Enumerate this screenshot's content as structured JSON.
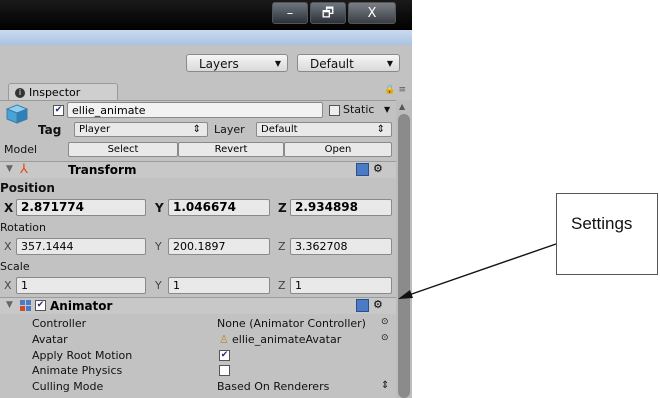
{
  "window": {
    "minimize": "–",
    "maximize": "🗗",
    "close": "X"
  },
  "toolbar": {
    "layers": "Layers",
    "layout": "Default"
  },
  "tab": {
    "label": "Inspector"
  },
  "object": {
    "name": "ellie_animate",
    "static_label": "Static",
    "tag_label": "Tag",
    "tag_value": "Player",
    "layer_label": "Layer",
    "layer_value": "Default",
    "model_label": "Model",
    "select": "Select",
    "revert": "Revert",
    "open": "Open"
  },
  "transform": {
    "title": "Transform",
    "position_label": "Position",
    "position": {
      "x": "2.871774",
      "y": "1.046674",
      "z": "2.934898"
    },
    "rotation_label": "Rotation",
    "rotation": {
      "x": "357.1444",
      "y": "200.1897",
      "z": "3.362708"
    },
    "scale_label": "Scale",
    "scale": {
      "x": "1",
      "y": "1",
      "z": "1"
    },
    "axis_x": "X",
    "axis_y": "Y",
    "axis_z": "Z"
  },
  "animator": {
    "title": "Animator",
    "controller_label": "Controller",
    "controller_value": "None (Animator Controller)",
    "avatar_label": "Avatar",
    "avatar_value": "ellie_animateAvatar",
    "apply_root_motion_label": "Apply Root Motion",
    "apply_root_motion": true,
    "animate_physics_label": "Animate Physics",
    "animate_physics": false,
    "culling_mode_label": "Culling Mode",
    "culling_mode_value": "Based On Renderers"
  },
  "annotation": {
    "label": "Settings"
  },
  "colors": {
    "panel": "#c2c2c2",
    "title_bar": "#000000",
    "selected_text": "#1c2f80"
  }
}
